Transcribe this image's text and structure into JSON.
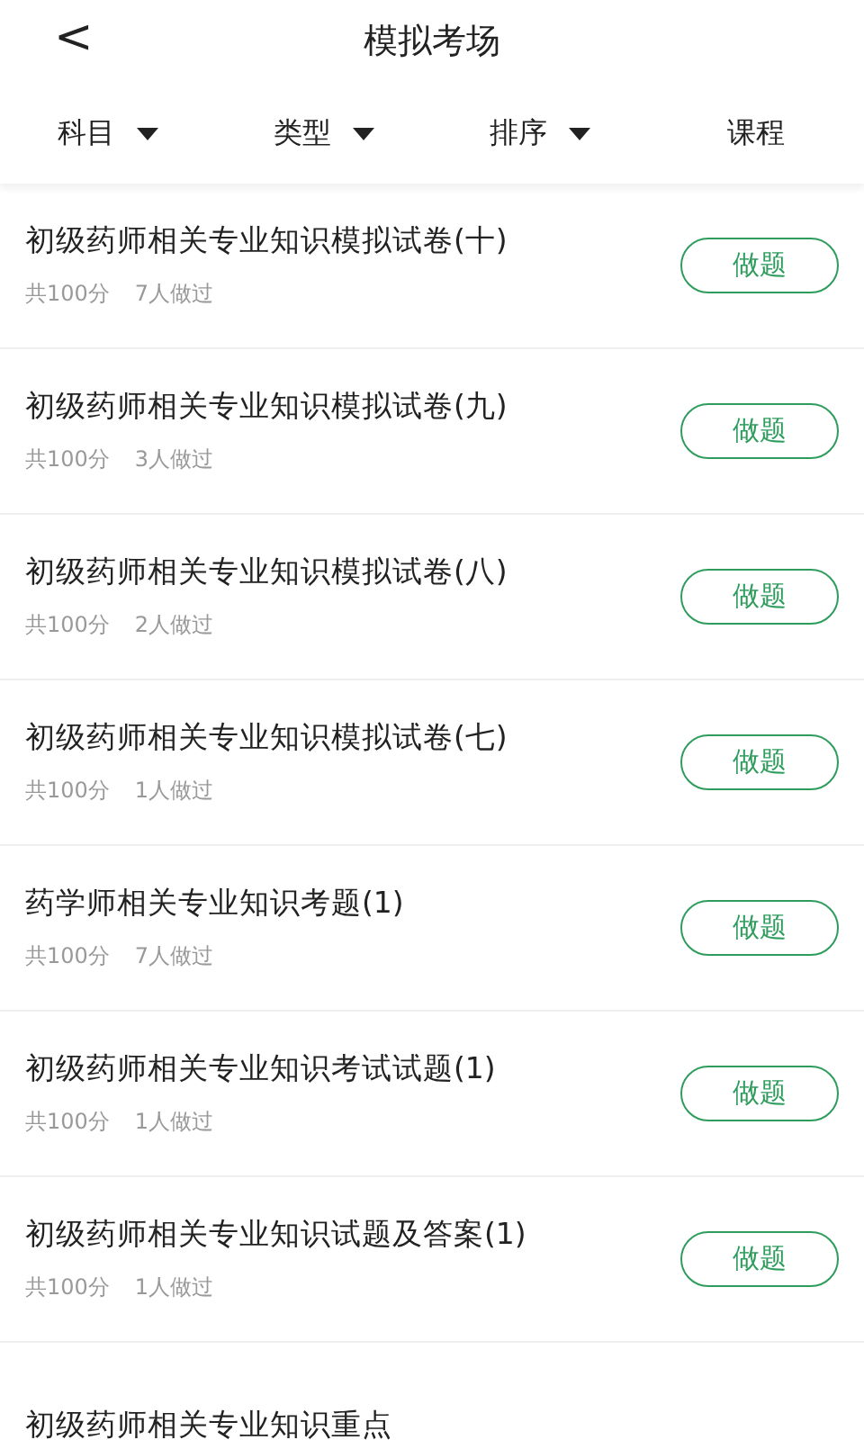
{
  "header": {
    "back": "<",
    "title": "模拟考场"
  },
  "filters": [
    {
      "label": "科目",
      "dropdown": true
    },
    {
      "label": "类型",
      "dropdown": true
    },
    {
      "label": "排序",
      "dropdown": true
    },
    {
      "label": "课程",
      "dropdown": false
    }
  ],
  "papers": [
    {
      "title": "初级药师相关专业知识模拟试卷(十)",
      "score": "共100分",
      "taken": "7人做过",
      "action": "做题"
    },
    {
      "title": "初级药师相关专业知识模拟试卷(九)",
      "score": "共100分",
      "taken": "3人做过",
      "action": "做题"
    },
    {
      "title": "初级药师相关专业知识模拟试卷(八)",
      "score": "共100分",
      "taken": "2人做过",
      "action": "做题"
    },
    {
      "title": "初级药师相关专业知识模拟试卷(七)",
      "score": "共100分",
      "taken": "1人做过",
      "action": "做题"
    },
    {
      "title": "药学师相关专业知识考题(1)",
      "score": "共100分",
      "taken": "7人做过",
      "action": "做题"
    },
    {
      "title": "初级药师相关专业知识考试试题(1)",
      "score": "共100分",
      "taken": "1人做过",
      "action": "做题"
    },
    {
      "title": "初级药师相关专业知识试题及答案(1)",
      "score": "共100分",
      "taken": "1人做过",
      "action": "做题"
    },
    {
      "title": "初级药师相关专业知识重点"
    }
  ]
}
